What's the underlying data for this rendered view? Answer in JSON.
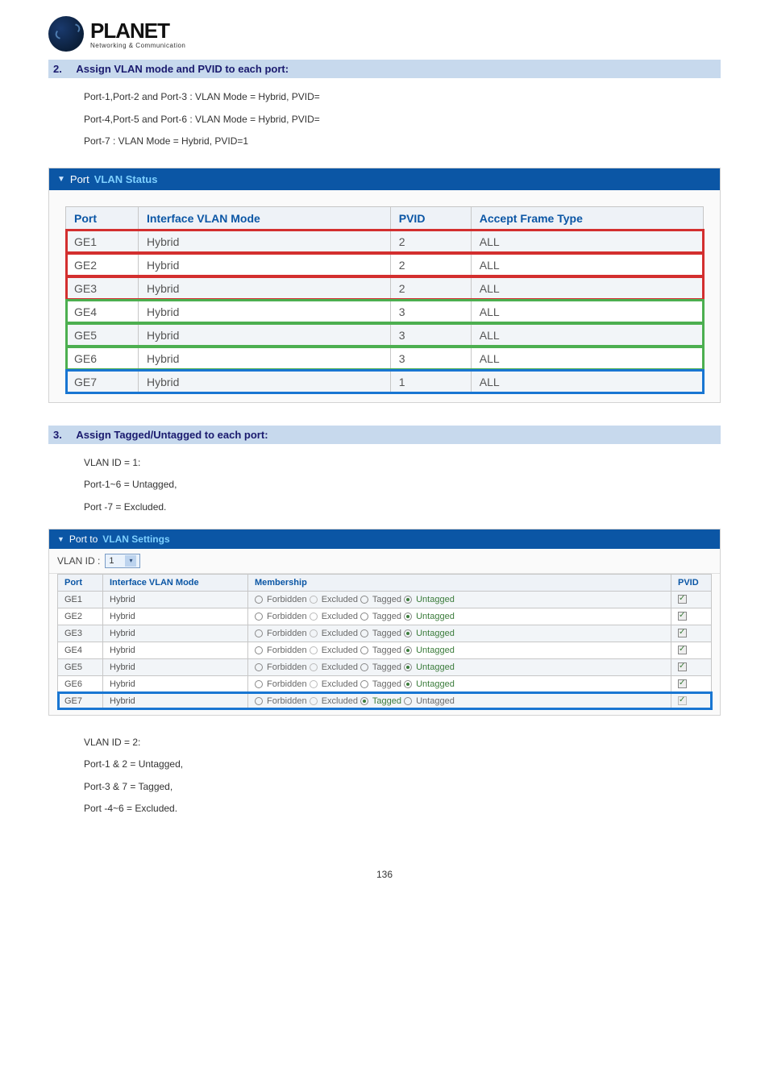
{
  "logo": {
    "brand": "PLANET",
    "tagline": "Networking & Communication"
  },
  "section2": {
    "num": "2.",
    "title": "Assign VLAN mode and PVID to each port:",
    "lines": [
      "Port-1,Port-2 and Port-3 : VLAN Mode = Hybrid, PVID=",
      "Port-4,Port-5 and Port-6 : VLAN Mode = Hybrid, PVID=",
      "Port-7 : VLAN Mode = Hybrid, PVID=1"
    ]
  },
  "statusPanel": {
    "titleWhite": "Port",
    "titleCyan": "VLAN Status",
    "headers": {
      "port": "Port",
      "mode": "Interface VLAN Mode",
      "pvid": "PVID",
      "accept": "Accept Frame Type"
    },
    "rows": [
      {
        "port": "GE1",
        "mode": "Hybrid",
        "pvid": "2",
        "accept": "ALL",
        "hi": "red",
        "zebra": true
      },
      {
        "port": "GE2",
        "mode": "Hybrid",
        "pvid": "2",
        "accept": "ALL",
        "hi": "red",
        "zebra": false
      },
      {
        "port": "GE3",
        "mode": "Hybrid",
        "pvid": "2",
        "accept": "ALL",
        "hi": "red",
        "zebra": true
      },
      {
        "port": "GE4",
        "mode": "Hybrid",
        "pvid": "3",
        "accept": "ALL",
        "hi": "green",
        "zebra": false
      },
      {
        "port": "GE5",
        "mode": "Hybrid",
        "pvid": "3",
        "accept": "ALL",
        "hi": "green",
        "zebra": true
      },
      {
        "port": "GE6",
        "mode": "Hybrid",
        "pvid": "3",
        "accept": "ALL",
        "hi": "green",
        "zebra": false
      },
      {
        "port": "GE7",
        "mode": "Hybrid",
        "pvid": "1",
        "accept": "ALL",
        "hi": "blue",
        "zebra": true
      }
    ]
  },
  "section3": {
    "num": "3.",
    "title": "Assign Tagged/Untagged to each port:",
    "lines": [
      "VLAN ID = 1:",
      "Port-1~6 = Untagged,",
      "Port -7 = Excluded."
    ]
  },
  "settingsPanel": {
    "titleWhite": "Port to",
    "titleCyan": "VLAN Settings",
    "vlanLabel": "VLAN ID :",
    "vlanValue": "1",
    "headers": {
      "port": "Port",
      "mode": "Interface VLAN Mode",
      "membership": "Membership",
      "pvid": "PVID"
    },
    "opts": {
      "forbidden": "Forbidden",
      "excluded": "Excluded",
      "tagged": "Tagged",
      "untagged": "Untagged"
    },
    "rows": [
      {
        "port": "GE1",
        "mode": "Hybrid",
        "sel": "untagged",
        "zebra": true,
        "hi": "",
        "pvid": "unchecked"
      },
      {
        "port": "GE2",
        "mode": "Hybrid",
        "sel": "untagged",
        "zebra": false,
        "hi": "",
        "pvid": "unchecked"
      },
      {
        "port": "GE3",
        "mode": "Hybrid",
        "sel": "untagged",
        "zebra": true,
        "hi": "",
        "pvid": "unchecked"
      },
      {
        "port": "GE4",
        "mode": "Hybrid",
        "sel": "untagged",
        "zebra": false,
        "hi": "",
        "pvid": "unchecked"
      },
      {
        "port": "GE5",
        "mode": "Hybrid",
        "sel": "untagged",
        "zebra": true,
        "hi": "",
        "pvid": "unchecked"
      },
      {
        "port": "GE6",
        "mode": "Hybrid",
        "sel": "untagged",
        "zebra": false,
        "hi": "",
        "pvid": "unchecked"
      },
      {
        "port": "GE7",
        "mode": "Hybrid",
        "sel": "tagged",
        "zebra": true,
        "hi": "blue",
        "pvid": "checked-disabled"
      }
    ]
  },
  "after3": [
    "VLAN ID = 2:",
    "Port-1 & 2 = Untagged,",
    "Port-3 & 7 = Tagged,",
    "Port -4~6 = Excluded."
  ],
  "pageNum": "136"
}
